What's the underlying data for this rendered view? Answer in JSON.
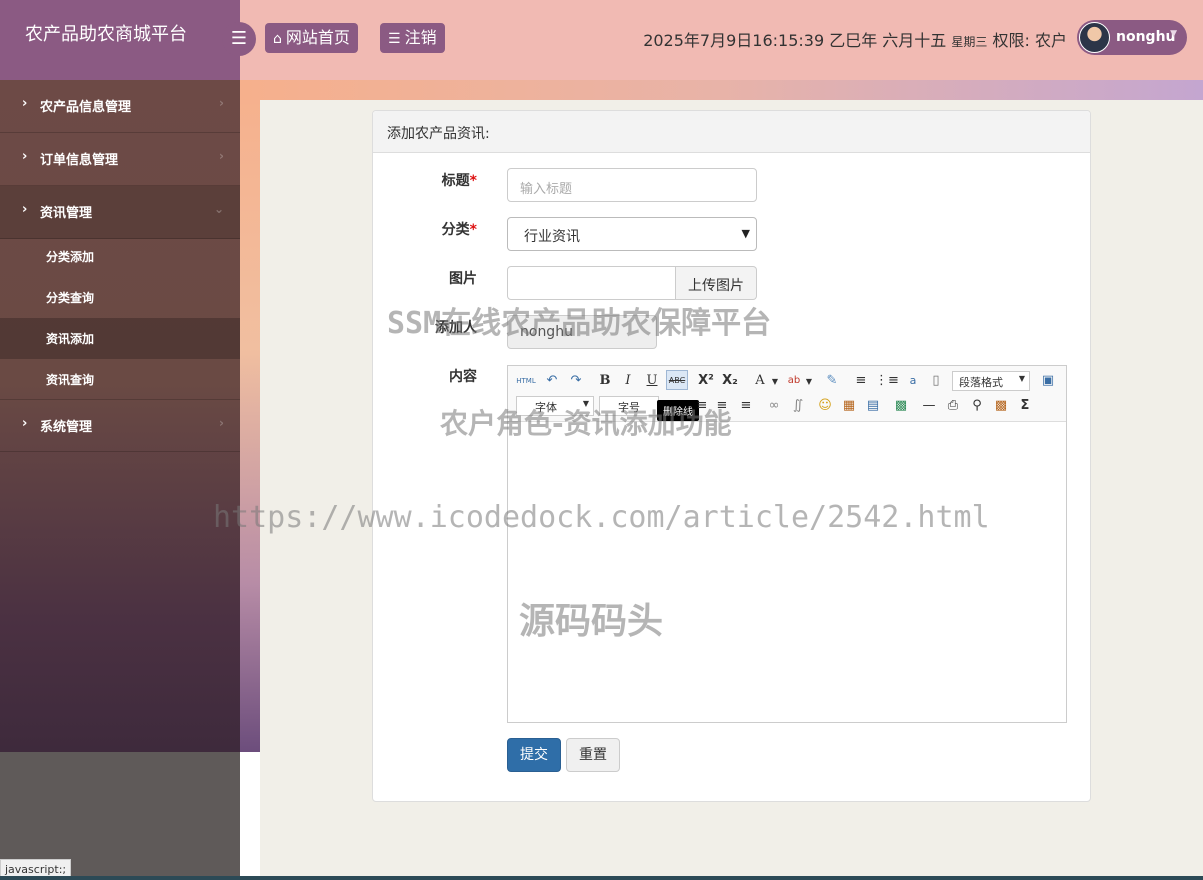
{
  "header": {
    "brand": "农产品助农商城平台",
    "menu_toggle_icon": "menu-icon",
    "home_label": "网站首页",
    "logout_label": "注销",
    "datetime": "2025年7月9日16:15:39 乙巳年 六月十五",
    "weekday": "星期三",
    "role": "权限: 农户",
    "username": "nonghu"
  },
  "sidebar": {
    "items": [
      {
        "label": "农产品信息管理"
      },
      {
        "label": "订单信息管理"
      },
      {
        "label": "资讯管理"
      },
      {
        "label": "系统管理"
      }
    ],
    "subitems": [
      {
        "label": "分类添加"
      },
      {
        "label": "分类查询"
      },
      {
        "label": "资讯添加"
      },
      {
        "label": "资讯查询"
      }
    ]
  },
  "form": {
    "panel_title": "添加农产品资讯:",
    "title_label": "标题",
    "title_placeholder": "输入标题",
    "category_label": "分类",
    "category_value": "行业资讯",
    "image_label": "图片",
    "upload_label": "上传图片",
    "adder_label": "添加人",
    "adder_value": "nonghu",
    "content_label": "内容",
    "submit_label": "提交",
    "reset_label": "重置",
    "required_mark": "*"
  },
  "editor": {
    "html_label": "HTML",
    "paragraph_select": "段落格式",
    "font_select": "字体",
    "size_select": "字号",
    "tooltip": "删除线"
  },
  "watermarks": {
    "line1": "SSM在线农产品助农保障平台",
    "line2": "农户角色-资讯添加功能",
    "line3": "https://www.icodedock.com/article/2542.html",
    "line4": "源码码头"
  },
  "statusbar": "javascript:;"
}
